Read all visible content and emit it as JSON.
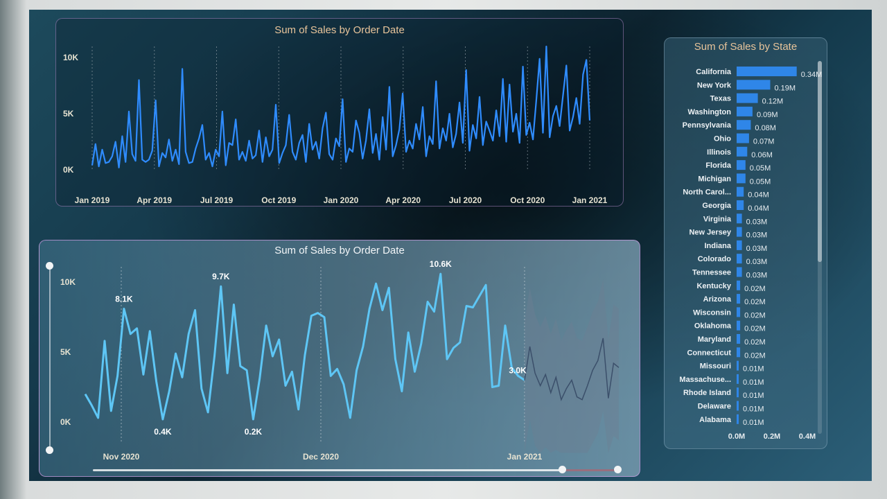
{
  "charts": {
    "top": {
      "title": "Sum of Sales by Order Date",
      "y_ticks": [
        "10K",
        "5K",
        "0K"
      ],
      "x_ticks": [
        "Jan 2019",
        "Apr 2019",
        "Jul 2019",
        "Oct 2019",
        "Jan 2020",
        "Apr 2020",
        "Jul 2020",
        "Oct 2020",
        "Jan 2021"
      ]
    },
    "bottom": {
      "title": "Sum of Sales by Order Date",
      "y_ticks": [
        "10K",
        "5K",
        "0K"
      ],
      "x_ticks": [
        "Nov 2020",
        "Dec 2020",
        "Jan 2021"
      ]
    },
    "state": {
      "title": "Sum of Sales by State",
      "x_ticks": [
        "0.0M",
        "0.2M",
        "0.4M"
      ]
    }
  },
  "chart_data": [
    {
      "type": "line",
      "title": "Sum of Sales by Order Date",
      "x_range": [
        "2019-01-01",
        "2021-01-01"
      ],
      "ylim": [
        0,
        11000
      ],
      "y_ticks": [
        0,
        5000,
        10000
      ],
      "series": [
        {
          "values": [
            400,
            2300,
            300,
            1800,
            600,
            700,
            1200,
            2500,
            200,
            3000,
            700,
            5200,
            1400,
            800,
            8000,
            900,
            700,
            900,
            1700,
            6200,
            300,
            1500,
            1100,
            2700,
            800,
            1800,
            500,
            9000,
            1600,
            600,
            700,
            1900,
            2800,
            4000,
            900,
            1500,
            300,
            1800,
            1200,
            5200,
            400,
            2400,
            2200,
            4500,
            900,
            1600,
            800,
            2600,
            1000,
            1300,
            3500,
            700,
            2900,
            1200,
            1800,
            5800,
            600,
            1500,
            2200,
            4900,
            1600,
            900,
            2400,
            3100,
            700,
            4100,
            1800,
            2500,
            1000,
            3700,
            5100,
            1400,
            900,
            2800,
            2100,
            6300,
            700,
            1900,
            1600,
            4400,
            3300,
            1000,
            2600,
            5400,
            1500,
            3200,
            900,
            4700,
            1800,
            7400,
            1200,
            2200,
            3600,
            6800,
            1600,
            2600,
            1900,
            4100,
            2700,
            5600,
            1200,
            3000,
            2300,
            7900,
            1900,
            3700,
            2600,
            5000,
            2000,
            3200,
            6000,
            2400,
            8900,
            1700,
            4000,
            2800,
            6500,
            2200,
            4300,
            3500,
            2600,
            5300,
            3000,
            8100,
            2500,
            7600,
            3400,
            5000,
            2400,
            9200,
            3100,
            4200,
            2700,
            6200,
            9900,
            3300,
            11000,
            2900,
            4800,
            5700,
            3900,
            6600,
            9300,
            3500,
            4700,
            6400,
            4100,
            8500,
            9800,
            4400
          ]
        }
      ]
    },
    {
      "type": "line",
      "title": "Sum of Sales by Order Date",
      "x_ticks": [
        "Nov 2020",
        "Dec 2020",
        "Jan 2021"
      ],
      "ylim": [
        0,
        11000
      ],
      "y_ticks": [
        0,
        5000,
        10000
      ],
      "series": [
        {
          "values": [
            2000,
            1200,
            300,
            5800,
            800,
            3300,
            8100,
            6300,
            6700,
            3400,
            6500,
            2900,
            200,
            2200,
            4900,
            3200,
            6300,
            8000,
            2400,
            700,
            4700,
            9700,
            3500,
            8400,
            4000,
            3700,
            200,
            3100,
            6900,
            4700,
            5900,
            2600,
            3600,
            900,
            4800,
            7600,
            7800,
            7500,
            3300,
            3800,
            2700,
            300,
            3700,
            5400,
            8100,
            9900,
            8000,
            9600,
            4500,
            2200,
            6400,
            3600,
            5600,
            8600,
            7900,
            10600,
            4500,
            5300,
            5700,
            8300,
            8200,
            9000,
            9800,
            2500,
            2600,
            6900,
            3900,
            3300,
            3000
          ],
          "data_labels": [
            "8.1K",
            "0.4K",
            "9.7K",
            "0.2K",
            "10.6K",
            "3.0K"
          ]
        },
        {
          "values": [
            3000,
            5400,
            3500,
            2600,
            3400,
            2100,
            3200,
            1600,
            2400,
            3000,
            1800,
            1600,
            2600,
            3700,
            4400,
            6000,
            1700,
            4200,
            3900
          ]
        }
      ]
    },
    {
      "type": "bar",
      "title": "Sum of Sales by State",
      "orientation": "horizontal",
      "xlim": [
        0,
        0.4
      ],
      "x_ticks": [
        "0.0M",
        "0.2M",
        "0.4M"
      ],
      "categories": [
        "California",
        "New York",
        "Texas",
        "Washington",
        "Pennsylvania",
        "Ohio",
        "Illinois",
        "Florida",
        "Michigan",
        "North Carol...",
        "Georgia",
        "Virginia",
        "New Jersey",
        "Indiana",
        "Colorado",
        "Tennessee",
        "Kentucky",
        "Arizona",
        "Wisconsin",
        "Oklahoma",
        "Maryland",
        "Connecticut",
        "Missouri",
        "Massachuse...",
        "Rhode Island",
        "Delaware",
        "Alabama"
      ],
      "values": [
        0.34,
        0.19,
        0.12,
        0.09,
        0.08,
        0.07,
        0.06,
        0.05,
        0.05,
        0.04,
        0.04,
        0.03,
        0.03,
        0.03,
        0.03,
        0.03,
        0.02,
        0.02,
        0.02,
        0.02,
        0.02,
        0.02,
        0.01,
        0.01,
        0.01,
        0.01,
        0.01
      ],
      "data_labels": [
        "0.34M",
        "0.19M",
        "0.12M",
        "0.09M",
        "0.08M",
        "0.07M",
        "0.06M",
        "0.05M",
        "0.05M",
        "0.04M",
        "0.04M",
        "0.03M",
        "0.03M",
        "0.03M",
        "0.03M",
        "0.03M",
        "0.02M",
        "0.02M",
        "0.02M",
        "0.02M",
        "0.02M",
        "0.02M",
        "0.01M",
        "0.01M",
        "0.01M",
        "0.01M",
        "0.01M"
      ]
    }
  ],
  "colors": {
    "top_line": "#2f8cff",
    "bottom_line": "#5ec6f5",
    "forecast_line": "#3b4f6a",
    "forecast_band": "#6d7f92",
    "bar": "#2f86e8",
    "grid": "#9ea9b0"
  }
}
